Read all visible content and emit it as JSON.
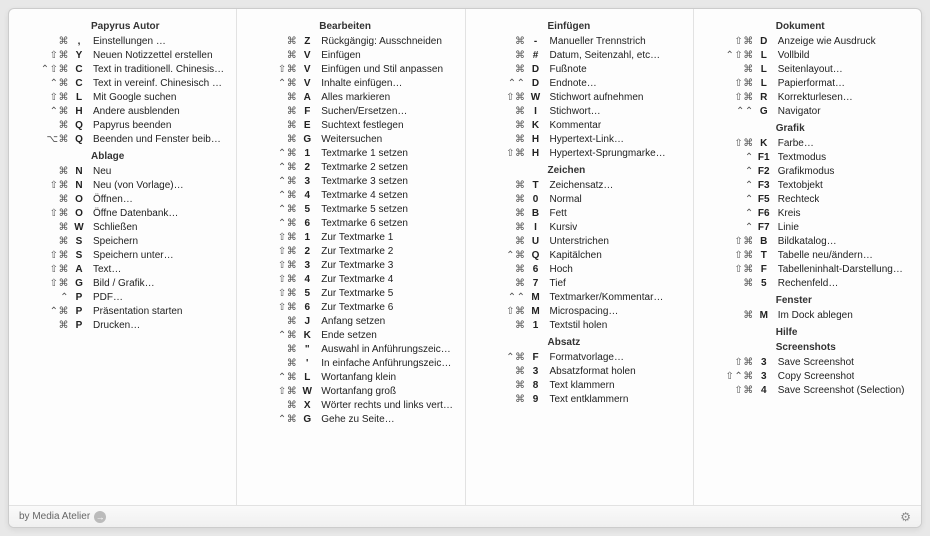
{
  "footer": {
    "credit": "by Media Atelier"
  },
  "columns": [
    {
      "sections": [
        {
          "title": "Papyrus Autor",
          "items": [
            {
              "mods": "⌘",
              "key": ",",
              "label": "Einstellungen …"
            },
            {
              "mods": "⇧⌘",
              "key": "Y",
              "label": "Neuen Notizzettel erstellen"
            },
            {
              "mods": "⌃⇧⌘",
              "key": "C",
              "label": "Text in traditionell. Chinesisch konvertie…"
            },
            {
              "mods": "⌃⌘",
              "key": "C",
              "label": "Text in vereinf. Chinesisch konvertieren"
            },
            {
              "mods": "⇧⌘",
              "key": "L",
              "label": "Mit Google suchen"
            },
            {
              "mods": "⌃⌘",
              "key": "H",
              "label": "Andere ausblenden"
            },
            {
              "mods": "⌘",
              "key": "Q",
              "label": "Papyrus beenden"
            },
            {
              "mods": "⌥⌘",
              "key": "Q",
              "label": "Beenden und Fenster beibehalten"
            }
          ]
        },
        {
          "title": "Ablage",
          "items": [
            {
              "mods": "⌘",
              "key": "N",
              "label": "Neu"
            },
            {
              "mods": "⇧⌘",
              "key": "N",
              "label": "Neu (von Vorlage)…"
            },
            {
              "mods": "⌘",
              "key": "O",
              "label": "Öffnen…"
            },
            {
              "mods": "⇧⌘",
              "key": "O",
              "label": "Öffne Datenbank…"
            },
            {
              "mods": "⌘",
              "key": "W",
              "label": "Schließen"
            },
            {
              "mods": "⌘",
              "key": "S",
              "label": "Speichern"
            },
            {
              "mods": "⇧⌘",
              "key": "S",
              "label": "Speichern unter…"
            },
            {
              "mods": "⇧⌘",
              "key": "A",
              "label": "Text…"
            },
            {
              "mods": "⇧⌘",
              "key": "G",
              "label": "Bild / Grafik…"
            },
            {
              "mods": "⌃",
              "key": "P",
              "label": "PDF…"
            },
            {
              "mods": "⌃⌘",
              "key": "P",
              "label": "Präsentation starten"
            },
            {
              "mods": "⌘",
              "key": "P",
              "label": "Drucken…"
            }
          ]
        }
      ]
    },
    {
      "sections": [
        {
          "title": "Bearbeiten",
          "items": [
            {
              "mods": "⌘",
              "key": "Z",
              "label": "Rückgängig: Ausschneiden"
            },
            {
              "mods": "⌘",
              "key": "V",
              "label": "Einfügen"
            },
            {
              "mods": "⇧⌘",
              "key": "V",
              "label": "Einfügen und Stil anpassen"
            },
            {
              "mods": "⌃⌘",
              "key": "V",
              "label": "Inhalte einfügen…"
            },
            {
              "mods": "⌘",
              "key": "A",
              "label": "Alles markieren"
            },
            {
              "mods": "⌘",
              "key": "F",
              "label": "Suchen/Ersetzen…"
            },
            {
              "mods": "⌘",
              "key": "E",
              "label": "Suchtext festlegen"
            },
            {
              "mods": "⌘",
              "key": "G",
              "label": "Weitersuchen"
            },
            {
              "mods": "⌃⌘",
              "key": "1",
              "label": "Textmarke 1 setzen"
            },
            {
              "mods": "⌃⌘",
              "key": "2",
              "label": "Textmarke 2 setzen"
            },
            {
              "mods": "⌃⌘",
              "key": "3",
              "label": "Textmarke 3 setzen"
            },
            {
              "mods": "⌃⌘",
              "key": "4",
              "label": "Textmarke 4 setzen"
            },
            {
              "mods": "⌃⌘",
              "key": "5",
              "label": "Textmarke 5 setzen"
            },
            {
              "mods": "⌃⌘",
              "key": "6",
              "label": "Textmarke 6 setzen"
            },
            {
              "mods": "⇧⌘",
              "key": "1",
              "label": "Zur Textmarke 1"
            },
            {
              "mods": "⇧⌘",
              "key": "2",
              "label": "Zur Textmarke 2"
            },
            {
              "mods": "⇧⌘",
              "key": "3",
              "label": "Zur Textmarke 3"
            },
            {
              "mods": "⇧⌘",
              "key": "4",
              "label": "Zur Textmarke 4"
            },
            {
              "mods": "⇧⌘",
              "key": "5",
              "label": "Zur Textmarke 5"
            },
            {
              "mods": "⇧⌘",
              "key": "6",
              "label": "Zur Textmarke 6"
            },
            {
              "mods": "⌘",
              "key": "J",
              "label": "Anfang setzen"
            },
            {
              "mods": "⌃⌘",
              "key": "K",
              "label": "Ende setzen"
            },
            {
              "mods": "⌘",
              "key": "\"",
              "label": "Auswahl in Anführungszeichen setzen"
            },
            {
              "mods": "⌘",
              "key": "'",
              "label": "In einfache Anführungszeichen setzen"
            },
            {
              "mods": "⌃⌘",
              "key": "L",
              "label": "Wortanfang klein"
            },
            {
              "mods": "⇧⌘",
              "key": "W",
              "label": "Wortanfang groß"
            },
            {
              "mods": "⌘",
              "key": "X",
              "label": "Wörter rechts und links vertauschen"
            },
            {
              "mods": "⌃⌘",
              "key": "G",
              "label": "Gehe zu Seite…"
            }
          ]
        }
      ]
    },
    {
      "sections": [
        {
          "title": "Einfügen",
          "items": [
            {
              "mods": "⌘",
              "key": "-",
              "label": "Manueller Trennstrich"
            },
            {
              "mods": "⌘",
              "key": "#",
              "label": "Datum, Seitenzahl, etc…"
            },
            {
              "mods": "⌘",
              "key": "D",
              "label": "Fußnote"
            },
            {
              "mods": "⌃⌃",
              "key": "D",
              "label": "Endnote…"
            },
            {
              "mods": "⇧⌘",
              "key": "W",
              "label": "Stichwort aufnehmen"
            },
            {
              "mods": "⌘",
              "key": "I",
              "label": "Stichwort…"
            },
            {
              "mods": "⌘",
              "key": "K",
              "label": "Kommentar"
            },
            {
              "mods": "⌘",
              "key": "H",
              "label": "Hypertext-Link…"
            },
            {
              "mods": "⇧⌘",
              "key": "H",
              "label": "Hypertext-Sprungmarke…"
            }
          ]
        },
        {
          "title": "Zeichen",
          "items": [
            {
              "mods": "⌘",
              "key": "T",
              "label": "Zeichensatz…"
            },
            {
              "mods": "⌘",
              "key": "0",
              "label": "Normal"
            },
            {
              "mods": "⌘",
              "key": "B",
              "label": "Fett"
            },
            {
              "mods": "⌘",
              "key": "I",
              "label": "Kursiv"
            },
            {
              "mods": "⌘",
              "key": "U",
              "label": "Unterstrichen"
            },
            {
              "mods": "⌃⌘",
              "key": "Q",
              "label": "Kapitälchen"
            },
            {
              "mods": "⌘",
              "key": "6",
              "label": "Hoch"
            },
            {
              "mods": "⌘",
              "key": "7",
              "label": "Tief"
            },
            {
              "mods": "⌃⌃",
              "key": "M",
              "label": "Textmarker/Kommentar…"
            },
            {
              "mods": "⇧⌘",
              "key": "M",
              "label": "Microspacing…"
            },
            {
              "mods": "⌘",
              "key": "1",
              "label": "Textstil holen"
            }
          ]
        },
        {
          "title": "Absatz",
          "items": [
            {
              "mods": "⌃⌘",
              "key": "F",
              "label": "Formatvorlage…"
            },
            {
              "mods": "⌘",
              "key": "3",
              "label": "Absatzformat holen"
            },
            {
              "mods": "⌘",
              "key": "8",
              "label": "Text klammern"
            },
            {
              "mods": "⌘",
              "key": "9",
              "label": "Text entklammern"
            }
          ]
        }
      ]
    },
    {
      "sections": [
        {
          "title": "Dokument",
          "items": [
            {
              "mods": "⇧⌘",
              "key": "D",
              "label": "Anzeige wie Ausdruck"
            },
            {
              "mods": "⌃⇧⌘",
              "key": "L",
              "label": "Vollbild"
            },
            {
              "mods": "⌘",
              "key": "L",
              "label": "Seitenlayout…"
            },
            {
              "mods": "⇧⌘",
              "key": "L",
              "label": "Papierformat…"
            },
            {
              "mods": "⇧⌘",
              "key": "R",
              "label": "Korrekturlesen…"
            },
            {
              "mods": "⌃⌃",
              "key": "G",
              "label": "Navigator"
            }
          ]
        },
        {
          "title": "Grafik",
          "items": [
            {
              "mods": "⇧⌘",
              "key": "K",
              "label": "Farbe…"
            },
            {
              "mods": "⌃",
              "key": "F1",
              "label": "Textmodus"
            },
            {
              "mods": "⌃",
              "key": "F2",
              "label": "Grafikmodus"
            },
            {
              "mods": "⌃",
              "key": "F3",
              "label": "Textobjekt"
            },
            {
              "mods": "⌃",
              "key": "F5",
              "label": "Rechteck"
            },
            {
              "mods": "⌃",
              "key": "F6",
              "label": "Kreis"
            },
            {
              "mods": "⌃",
              "key": "F7",
              "label": "Linie"
            },
            {
              "mods": "⇧⌘",
              "key": "B",
              "label": "Bildkatalog…"
            },
            {
              "mods": "⇧⌘",
              "key": "T",
              "label": "Tabelle neu/ändern…"
            },
            {
              "mods": "⇧⌘",
              "key": "F",
              "label": "Tabelleninhalt-Darstellung…"
            },
            {
              "mods": "⌘",
              "key": "5",
              "label": "Rechenfeld…"
            }
          ]
        },
        {
          "title": "Fenster",
          "items": [
            {
              "mods": "⌘",
              "key": "M",
              "label": "Im Dock ablegen"
            }
          ]
        },
        {
          "title": "Hilfe",
          "items": []
        },
        {
          "title": "Screenshots",
          "items": [
            {
              "mods": "⇧⌘",
              "key": "3",
              "label": "Save Screenshot"
            },
            {
              "mods": "⇧⌃⌘",
              "key": "3",
              "label": "Copy Screenshot"
            },
            {
              "mods": "⇧⌘",
              "key": "4",
              "label": "Save Screenshot (Selection)"
            }
          ]
        }
      ]
    }
  ]
}
